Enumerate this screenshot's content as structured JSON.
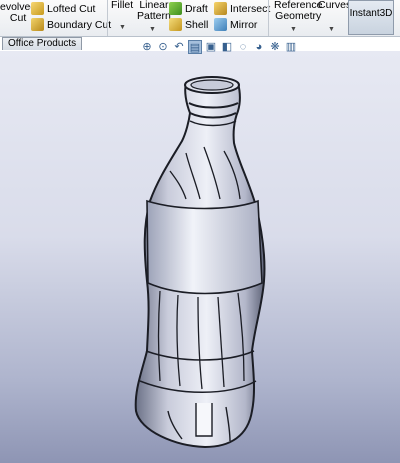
{
  "ribbon": {
    "revolved_cut": [
      "evolved",
      "Cut"
    ],
    "lofted_cut": "Lofted Cut",
    "boundary_cut": "Boundary Cut",
    "fillet": "Fillet",
    "linear_pattern": [
      "Linear",
      "Pattern"
    ],
    "draft": "Draft",
    "shell": "Shell",
    "intersect": "Intersect",
    "mirror": "Mirror",
    "reference_geometry": [
      "Reference",
      "Geometry"
    ],
    "curves": "Curves",
    "instant3d": "Instant3D"
  },
  "tabs": {
    "office_products": "Office Products"
  },
  "icons": [
    "zoom-to-fit-icon",
    "zoom-area-icon",
    "previous-view-icon",
    "section-view-icon",
    "view-orientation-icon",
    "display-style-icon",
    "hide-show-icon",
    "edit-appearance-icon",
    "apply-scene-icon",
    "view-settings-icon"
  ],
  "colors": {
    "viewport_top": "#e7e9f3",
    "viewport_bottom": "#8e95b4",
    "model": "#d8dbe8"
  }
}
